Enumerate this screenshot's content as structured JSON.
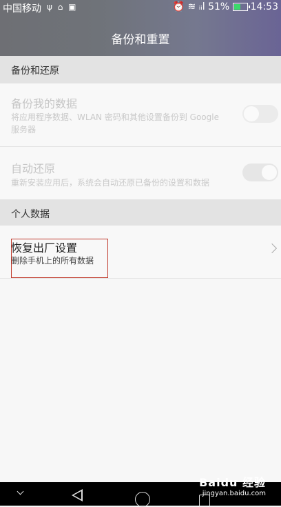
{
  "status_bar": {
    "carrier": "中国移动",
    "left_icons": "ψ ⌂ ▣",
    "right_icons": "⏰ ≋ ᵢᵢl",
    "battery": "51%",
    "time": "14:53"
  },
  "header": {
    "title": "备份和重置"
  },
  "sections": [
    {
      "label": "备份和还原"
    },
    {
      "label": "个人数据"
    }
  ],
  "items": [
    {
      "title": "备份我的数据",
      "subtitle": "将应用程序数据、WLAN 密码和其他设置备份到 Google 服务器",
      "toggle": false
    },
    {
      "title": "自动还原",
      "subtitle": "重新安装应用后，系统会自动还原已备份的设置和数据",
      "toggle": true
    },
    {
      "title": "恢复出厂设置",
      "subtitle": "删除手机上的所有数据"
    }
  ],
  "watermark": {
    "brand": "Baidu 经验",
    "url": "jingyan.baidu.com"
  }
}
